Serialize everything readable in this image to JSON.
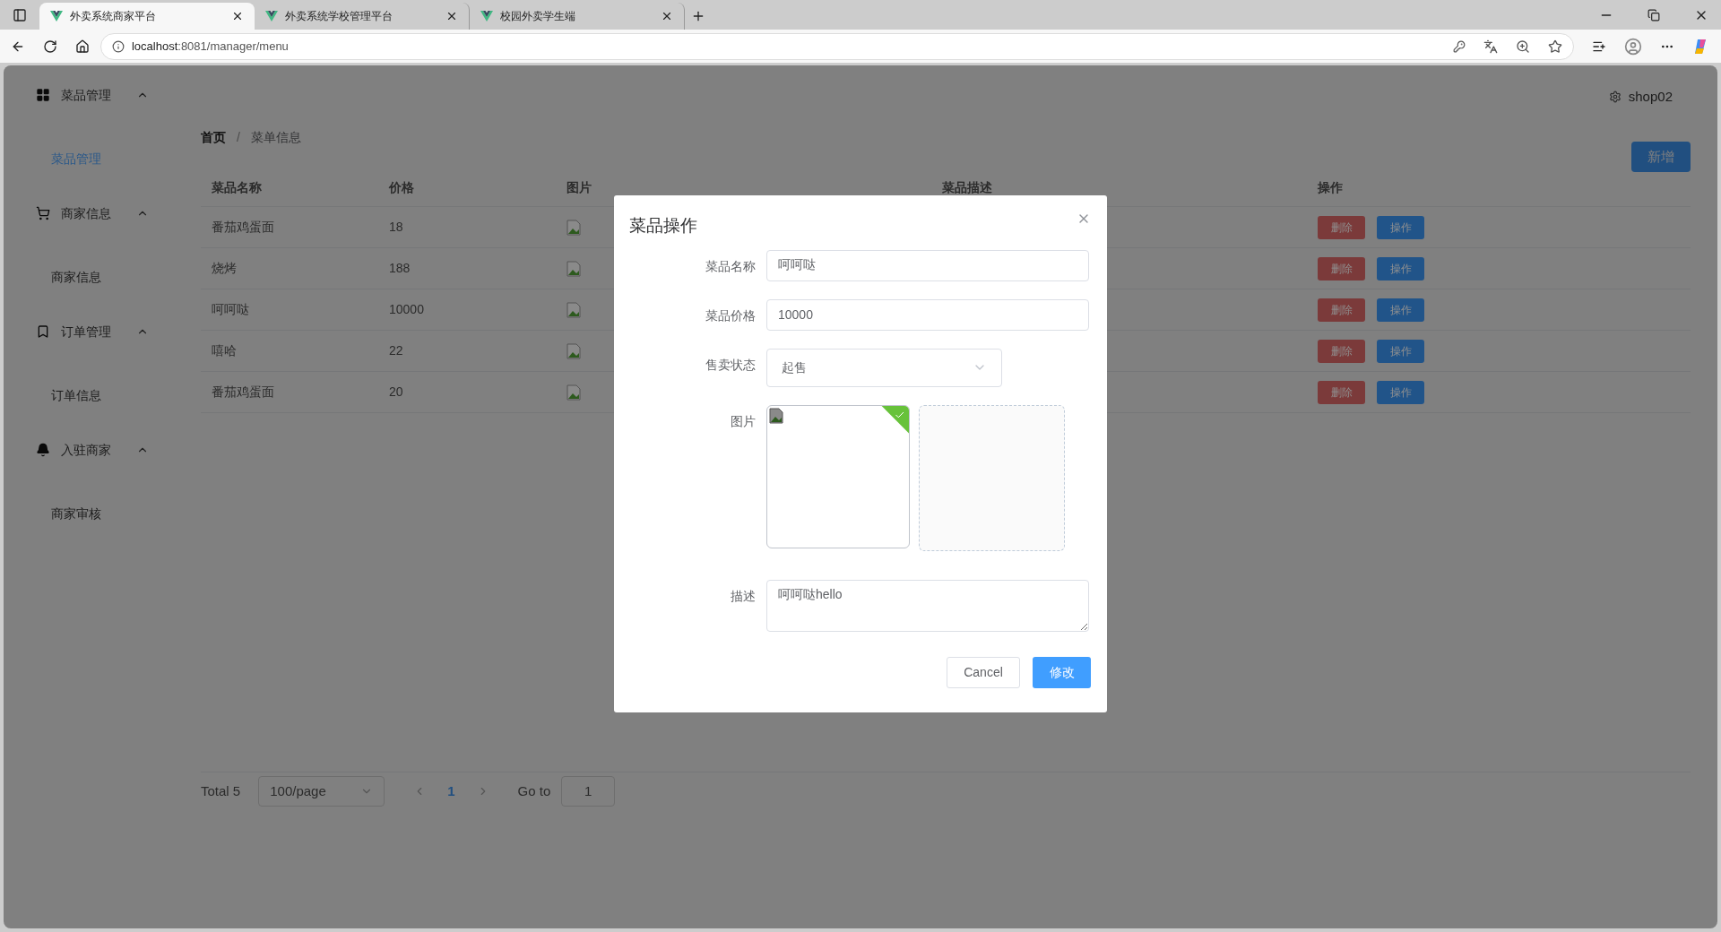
{
  "browser": {
    "tabs": [
      {
        "title": "外卖系统商家平台",
        "selected": true
      },
      {
        "title": "外卖系统学校管理平台",
        "selected": false
      },
      {
        "title": "校园外卖学生端",
        "selected": false
      }
    ],
    "url_host": "localhost",
    "url_rest": ":8081/manager/menu"
  },
  "sidebar": [
    {
      "label": "菜品管理",
      "expanded": true,
      "children": [
        {
          "label": "菜品管理",
          "selected": true
        }
      ]
    },
    {
      "label": "商家信息",
      "expanded": true,
      "children": [
        {
          "label": "商家信息",
          "selected": false
        }
      ]
    },
    {
      "label": "订单管理",
      "expanded": true,
      "children": [
        {
          "label": "订单信息",
          "selected": false
        }
      ]
    },
    {
      "label": "入驻商家",
      "expanded": true,
      "children": [
        {
          "label": "商家审核",
          "selected": false
        }
      ]
    }
  ],
  "header": {
    "user": "shop02"
  },
  "breadcrumb": {
    "items": [
      "首页",
      "菜单信息"
    ],
    "separator": "/"
  },
  "add_button": "新增",
  "table": {
    "columns": [
      "菜品名称",
      "价格",
      "图片",
      "菜品描述",
      "操作"
    ],
    "rows": [
      {
        "name": "番茄鸡蛋面",
        "price": "18",
        "actions": [
          "删除",
          "操作"
        ]
      },
      {
        "name": "烧烤",
        "price": "188",
        "actions": [
          "删除",
          "操作"
        ]
      },
      {
        "name": "呵呵哒",
        "price": "10000",
        "actions": [
          "删除",
          "操作"
        ]
      },
      {
        "name": "嘻哈",
        "price": "22",
        "actions": [
          "删除",
          "操作"
        ]
      },
      {
        "name": "番茄鸡蛋面",
        "price": "20",
        "actions": [
          "删除",
          "操作"
        ]
      }
    ]
  },
  "pagination": {
    "total": "Total 5",
    "page_size": "100/page",
    "pages": [
      {
        "label": "1",
        "selected": true
      }
    ],
    "goto_label": "Go to",
    "goto_value": "1"
  },
  "dialog": {
    "title": "菜品操作",
    "fields": [
      {
        "kind": "input",
        "label": "菜品名称",
        "value": "呵呵哒"
      },
      {
        "kind": "input",
        "label": "菜品价格",
        "value": "10000"
      },
      {
        "kind": "select",
        "label": "售卖状态",
        "value": "起售"
      },
      {
        "kind": "upload",
        "label": "图片",
        "success": true
      },
      {
        "kind": "textarea",
        "label": "描述",
        "value": "呵呵哒hello"
      }
    ],
    "buttons": [
      "Cancel",
      "修改"
    ]
  }
}
